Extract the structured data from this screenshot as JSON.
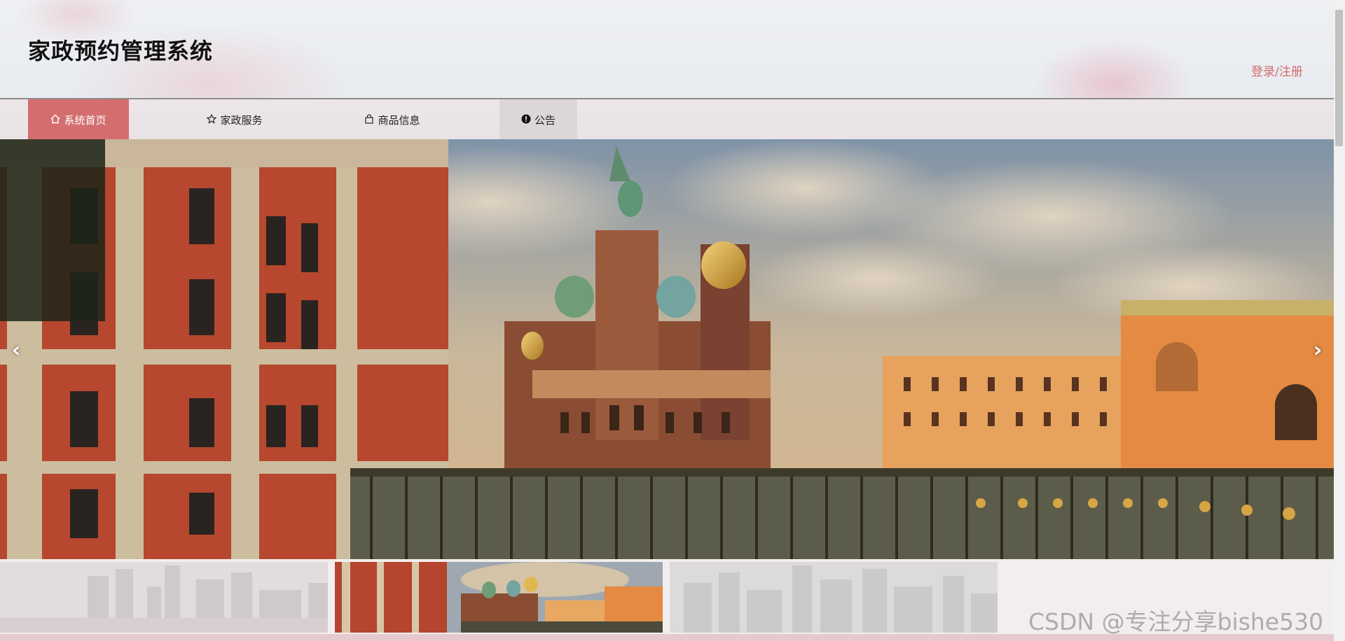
{
  "header": {
    "site_title": "家政预约管理系统",
    "login_label": "登录/注册"
  },
  "nav": {
    "items": [
      {
        "label": "系统首页",
        "icon": "home-icon",
        "active": true
      },
      {
        "label": "家政服务",
        "icon": "star-icon",
        "active": false
      },
      {
        "label": "商品信息",
        "icon": "bag-icon",
        "active": false
      },
      {
        "label": "公告",
        "icon": "exclamation-circle-icon",
        "active": false
      }
    ]
  },
  "carousel": {
    "prev_icon": "chevron-left-icon",
    "next_icon": "chevron-right-icon",
    "thumbnails": [
      {
        "name": "city-skyline-thumbnail",
        "active": false
      },
      {
        "name": "church-thumbnail",
        "active": true
      },
      {
        "name": "city-grey-thumbnail",
        "active": false
      }
    ]
  },
  "watermark": "CSDN @专注分享bishe530",
  "colors": {
    "accent": "#d46e6e",
    "login_text": "#d36b6b",
    "nav_bg": "#e9e3e5"
  }
}
